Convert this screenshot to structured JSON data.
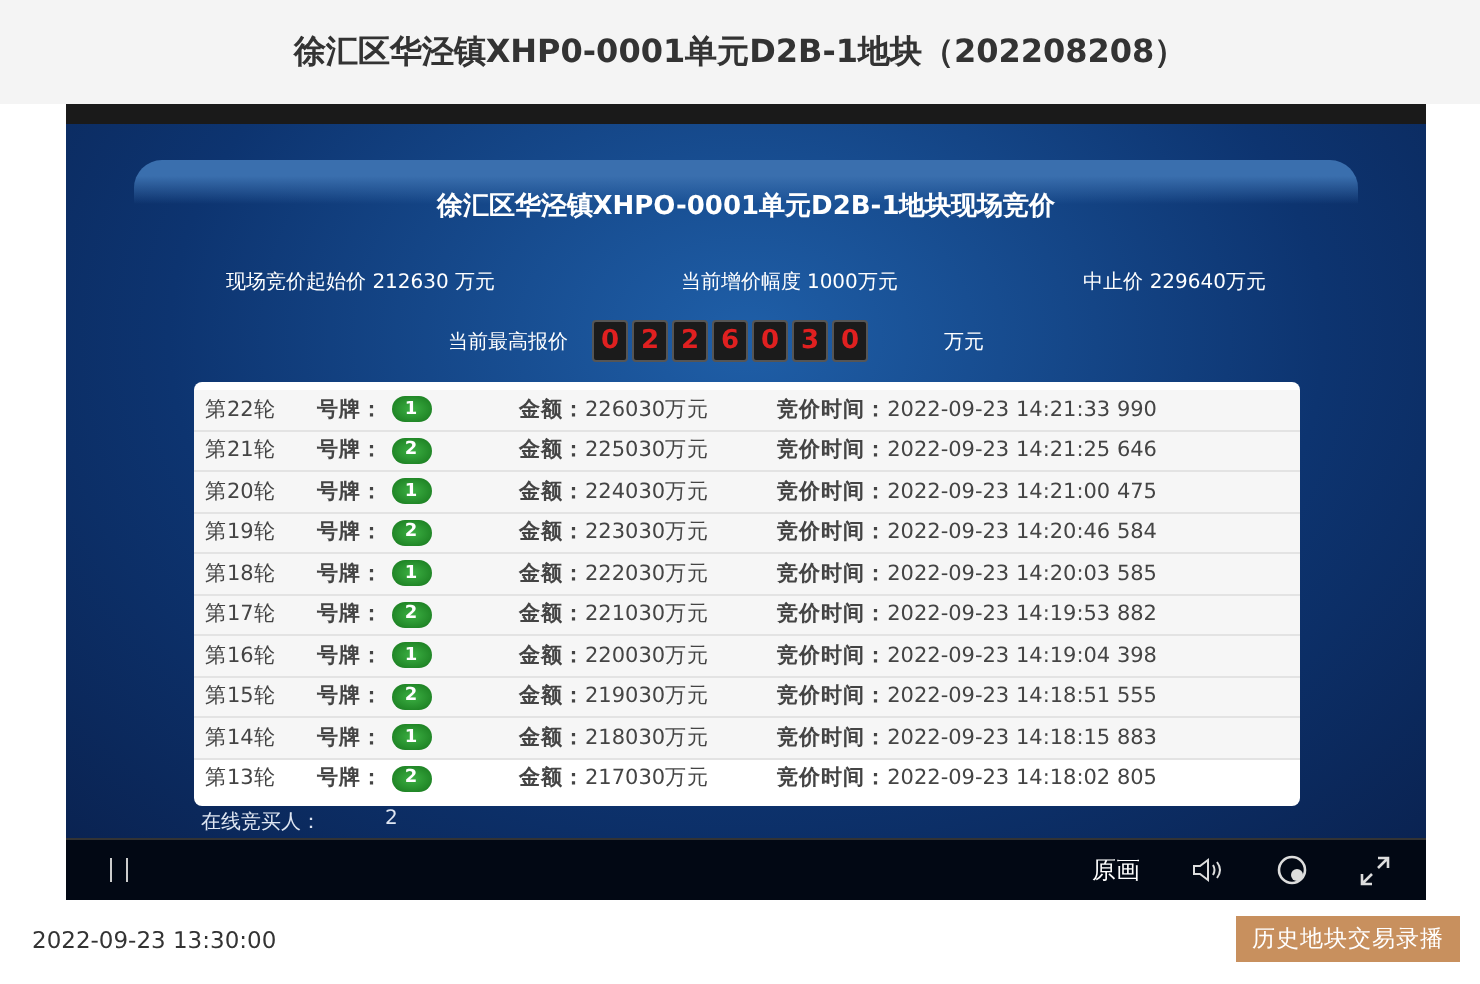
{
  "page_title": "徐汇区华泾镇XHP0-0001单元D2B-1地块（202208208）",
  "video": {
    "screen": {
      "title": "徐汇区华泾镇XHPO-0001单元D2B-1地块现场竞价",
      "info": [
        {
          "label": "现场竞价起始价",
          "value": "212630 万元"
        },
        {
          "label": "当前增价幅度",
          "value": "1000万元"
        },
        {
          "label": "中止价",
          "value": "229640万元"
        }
      ],
      "highest_bid": {
        "label": "当前最高报价",
        "digits": [
          "0",
          "2",
          "2",
          "6",
          "0",
          "3",
          "0"
        ],
        "unit": "万元"
      },
      "bids": [
        {
          "round": "第22轮",
          "plate_label": "号牌：",
          "plate": "1",
          "amount_label": "金额：",
          "amount": "226030万元",
          "time_label": "竞价时间：",
          "time": "2022-09-23 14:21:33 990"
        },
        {
          "round": "第21轮",
          "plate_label": "号牌：",
          "plate": "2",
          "amount_label": "金额：",
          "amount": "225030万元",
          "time_label": "竞价时间：",
          "time": "2022-09-23 14:21:25 646"
        },
        {
          "round": "第20轮",
          "plate_label": "号牌：",
          "plate": "1",
          "amount_label": "金额：",
          "amount": "224030万元",
          "time_label": "竞价时间：",
          "time": "2022-09-23 14:21:00 475"
        },
        {
          "round": "第19轮",
          "plate_label": "号牌：",
          "plate": "2",
          "amount_label": "金额：",
          "amount": "223030万元",
          "time_label": "竞价时间：",
          "time": "2022-09-23 14:20:46 584"
        },
        {
          "round": "第18轮",
          "plate_label": "号牌：",
          "plate": "1",
          "amount_label": "金额：",
          "amount": "222030万元",
          "time_label": "竞价时间：",
          "time": "2022-09-23 14:20:03 585"
        },
        {
          "round": "第17轮",
          "plate_label": "号牌：",
          "plate": "2",
          "amount_label": "金额：",
          "amount": "221030万元",
          "time_label": "竞价时间：",
          "time": "2022-09-23 14:19:53 882"
        },
        {
          "round": "第16轮",
          "plate_label": "号牌：",
          "plate": "1",
          "amount_label": "金额：",
          "amount": "220030万元",
          "time_label": "竞价时间：",
          "time": "2022-09-23 14:19:04 398"
        },
        {
          "round": "第15轮",
          "plate_label": "号牌：",
          "plate": "2",
          "amount_label": "金额：",
          "amount": "219030万元",
          "time_label": "竞价时间：",
          "time": "2022-09-23 14:18:51 555"
        },
        {
          "round": "第14轮",
          "plate_label": "号牌：",
          "plate": "1",
          "amount_label": "金额：",
          "amount": "218030万元",
          "time_label": "竞价时间：",
          "time": "2022-09-23 14:18:15 883"
        },
        {
          "round": "第13轮",
          "plate_label": "号牌：",
          "plate": "2",
          "amount_label": "金额：",
          "amount": "217030万元",
          "time_label": "竞价时间：",
          "time": "2022-09-23 14:18:02 805"
        }
      ],
      "online": {
        "label": "在线竞买人：",
        "value": "2"
      }
    },
    "controls": {
      "quality": "原画"
    }
  },
  "date": "2022-09-23 13:30:00",
  "history_button": "历史地块交易录播"
}
